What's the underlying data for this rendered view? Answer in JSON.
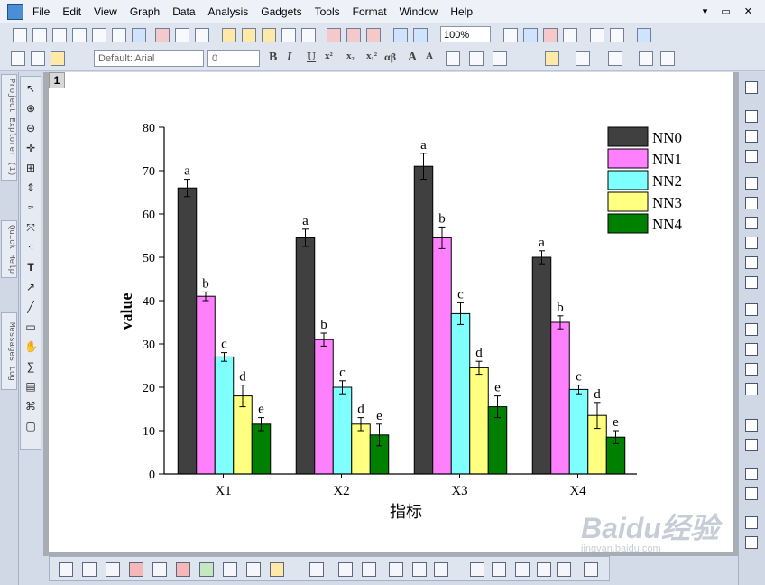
{
  "menu": [
    "File",
    "Edit",
    "View",
    "Graph",
    "Data",
    "Analysis",
    "Gadgets",
    "Tools",
    "Format",
    "Window",
    "Help"
  ],
  "toolbar": {
    "zoom": "100%",
    "font_name": "Default: Arial",
    "font_size": "0",
    "format_labels": [
      "B",
      "I",
      "U",
      "x²",
      "x₂",
      "x₁²",
      "αβ",
      "A",
      "A"
    ]
  },
  "left_dock": {
    "tabs": [
      "Project Explorer (1)",
      "Quick Help",
      "Messages Log"
    ]
  },
  "layer_label": "1",
  "chart_data": {
    "type": "bar",
    "categories": [
      "X1",
      "X2",
      "X3",
      "X4"
    ],
    "series": [
      {
        "name": "NN0",
        "color": "#404040",
        "values": [
          66,
          54.5,
          71,
          50
        ],
        "errors": [
          2,
          2,
          3,
          1.5
        ],
        "labels": [
          "a",
          "a",
          "a",
          "a"
        ]
      },
      {
        "name": "NN1",
        "color": "#ff80ff",
        "values": [
          41,
          31,
          54.5,
          35
        ],
        "errors": [
          1,
          1.5,
          2.5,
          1.5
        ],
        "labels": [
          "b",
          "b",
          "b",
          "b"
        ]
      },
      {
        "name": "NN2",
        "color": "#80ffff",
        "values": [
          27,
          20,
          37,
          19.5
        ],
        "errors": [
          1,
          1.5,
          2.5,
          1
        ],
        "labels": [
          "c",
          "c",
          "c",
          "c"
        ]
      },
      {
        "name": "NN3",
        "color": "#ffff80",
        "values": [
          18,
          11.5,
          24.5,
          13.5
        ],
        "errors": [
          2.5,
          1.5,
          1.5,
          3
        ],
        "labels": [
          "d",
          "d",
          "d",
          "d"
        ]
      },
      {
        "name": "NN4",
        "color": "#008000",
        "values": [
          11.5,
          9,
          15.5,
          8.5
        ],
        "errors": [
          1.5,
          2.5,
          2.5,
          1.5
        ],
        "labels": [
          "e",
          "e",
          "e",
          "e"
        ]
      }
    ],
    "xlabel": "指标",
    "ylabel": "value",
    "ylim": [
      0,
      80
    ],
    "yticks": [
      0,
      10,
      20,
      30,
      40,
      50,
      60,
      70,
      80
    ],
    "legend_position": "top-right",
    "grid": false
  },
  "watermark": {
    "logo": "Baidu经验",
    "url": "jingyan.baidu.com"
  }
}
